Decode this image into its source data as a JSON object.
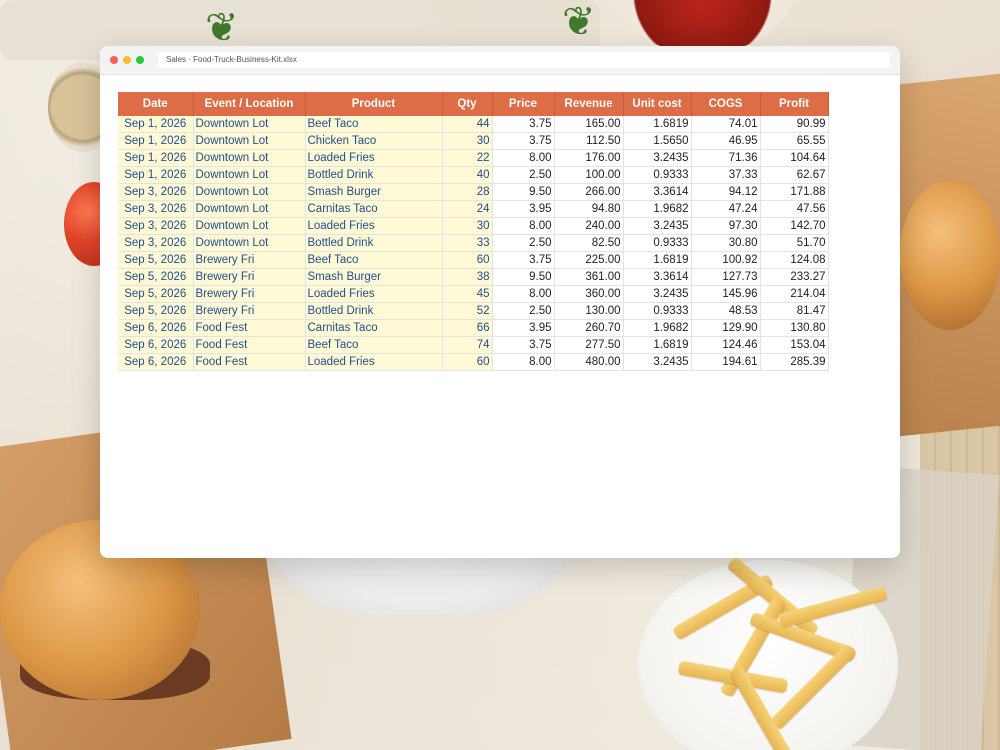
{
  "window": {
    "tab_title": "Sales · Food-Truck-Business-Kit.xlsx"
  },
  "colors": {
    "header_bg": "#dc6d47",
    "input_cell_bg": "#fff9d6",
    "input_text": "#1f4f8a"
  },
  "table": {
    "headers": [
      "Date",
      "Event / Location",
      "Product",
      "Qty",
      "Price",
      "Revenue",
      "Unit cost",
      "COGS",
      "Profit"
    ],
    "rows": [
      [
        "Sep 1, 2026",
        "Downtown Lot",
        "Beef Taco",
        "44",
        "3.75",
        "165.00",
        "1.6819",
        "74.01",
        "90.99"
      ],
      [
        "Sep 1, 2026",
        "Downtown Lot",
        "Chicken Taco",
        "30",
        "3.75",
        "112.50",
        "1.5650",
        "46.95",
        "65.55"
      ],
      [
        "Sep 1, 2026",
        "Downtown Lot",
        "Loaded Fries",
        "22",
        "8.00",
        "176.00",
        "3.2435",
        "71.36",
        "104.64"
      ],
      [
        "Sep 1, 2026",
        "Downtown Lot",
        "Bottled Drink",
        "40",
        "2.50",
        "100.00",
        "0.9333",
        "37.33",
        "62.67"
      ],
      [
        "Sep 3, 2026",
        "Downtown Lot",
        "Smash Burger",
        "28",
        "9.50",
        "266.00",
        "3.3614",
        "94.12",
        "171.88"
      ],
      [
        "Sep 3, 2026",
        "Downtown Lot",
        "Carnitas Taco",
        "24",
        "3.95",
        "94.80",
        "1.9682",
        "47.24",
        "47.56"
      ],
      [
        "Sep 3, 2026",
        "Downtown Lot",
        "Loaded Fries",
        "30",
        "8.00",
        "240.00",
        "3.2435",
        "97.30",
        "142.70"
      ],
      [
        "Sep 3, 2026",
        "Downtown Lot",
        "Bottled Drink",
        "33",
        "2.50",
        "82.50",
        "0.9333",
        "30.80",
        "51.70"
      ],
      [
        "Sep 5, 2026",
        "Brewery Fri",
        "Beef Taco",
        "60",
        "3.75",
        "225.00",
        "1.6819",
        "100.92",
        "124.08"
      ],
      [
        "Sep 5, 2026",
        "Brewery Fri",
        "Smash Burger",
        "38",
        "9.50",
        "361.00",
        "3.3614",
        "127.73",
        "233.27"
      ],
      [
        "Sep 5, 2026",
        "Brewery Fri",
        "Loaded Fries",
        "45",
        "8.00",
        "360.00",
        "3.2435",
        "145.96",
        "214.04"
      ],
      [
        "Sep 5, 2026",
        "Brewery Fri",
        "Bottled Drink",
        "52",
        "2.50",
        "130.00",
        "0.9333",
        "48.53",
        "81.47"
      ],
      [
        "Sep 6, 2026",
        "Food Fest",
        "Carnitas Taco",
        "66",
        "3.95",
        "260.70",
        "1.9682",
        "129.90",
        "130.80"
      ],
      [
        "Sep 6, 2026",
        "Food Fest",
        "Beef Taco",
        "74",
        "3.75",
        "277.50",
        "1.6819",
        "124.46",
        "153.04"
      ],
      [
        "Sep 6, 2026",
        "Food Fest",
        "Loaded Fries",
        "60",
        "8.00",
        "480.00",
        "3.2435",
        "194.61",
        "285.39"
      ]
    ]
  }
}
